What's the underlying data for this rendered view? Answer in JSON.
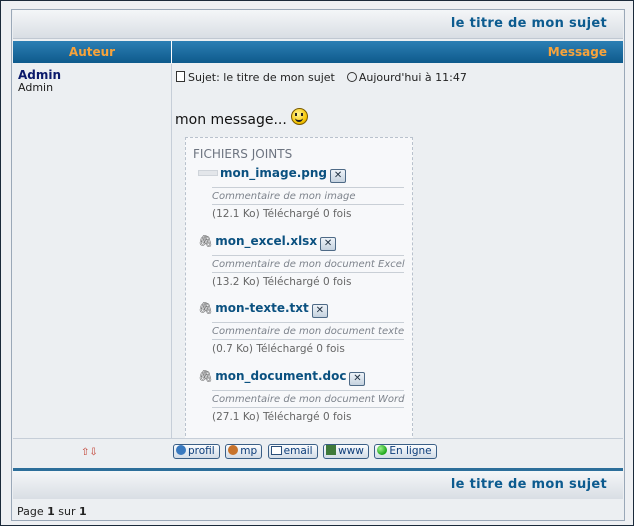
{
  "topic": {
    "title": "le titre de mon sujet"
  },
  "table_headers": {
    "author": "Auteur",
    "message": "Message"
  },
  "post": {
    "author_name": "Admin",
    "author_rank": "Admin",
    "subject_label": "Sujet: le titre de mon sujet",
    "date": "Aujourd'hui à 11:47",
    "message": "mon message...",
    "attachments_title": "FICHIERS JOINTS",
    "attachments": [
      {
        "name": "mon_image.png",
        "icon": "image-thumb-icon",
        "comment": "Commentaire de mon image",
        "stats": "(12.1 Ko) Téléchargé 0 fois"
      },
      {
        "name": "mon_excel.xlsx",
        "icon": "paperclip-icon",
        "comment": "Commentaire de mon document Excel",
        "stats": "(13.2 Ko) Téléchargé 0 fois"
      },
      {
        "name": "mon-texte.txt",
        "icon": "paperclip-icon",
        "comment": "Commentaire de mon document texte",
        "stats": "(0.7 Ko) Téléchargé 0 fois"
      },
      {
        "name": "mon_document.doc",
        "icon": "paperclip-icon",
        "comment": "Commentaire de mon document Word",
        "stats": "(27.1 Ko) Téléchargé 0 fois"
      }
    ]
  },
  "profile_buttons": {
    "profil": "profil",
    "mp": "mp",
    "email": "email",
    "www": "www",
    "online": "En ligne"
  },
  "pagination": {
    "prefix": "Page",
    "current": "1",
    "sep": "sur",
    "total": "1"
  },
  "colors": {
    "header_blue": "#0e5a8c",
    "header_orange": "#f7a33b",
    "title_blue": "#0c5b8f",
    "author_blue": "#0b1a6b"
  }
}
